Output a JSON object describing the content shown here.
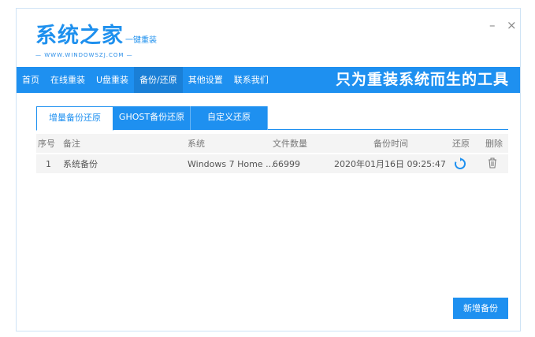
{
  "logo": {
    "main": "系统之家",
    "sub": "一键重装",
    "url": "— WWW.WINDOWSZJ.COM —"
  },
  "window": {
    "minimize": "–",
    "close": "×"
  },
  "nav": {
    "items": [
      "首页",
      "在线重装",
      "U盘重装",
      "备份/还原",
      "其他设置",
      "联系我们"
    ],
    "slogan": "只为重装系统而生的工具"
  },
  "tabs": [
    "增量备份还原",
    "GHOST备份还原",
    "自定义还原"
  ],
  "table": {
    "headers": [
      "序号",
      "备注",
      "系统",
      "文件数量",
      "备份时间",
      "还原",
      "删除"
    ],
    "rows": [
      {
        "index": "1",
        "note": "系统备份",
        "system": "Windows 7 Home ...",
        "count": "66999",
        "time": "2020年01月16日 09:25:47"
      }
    ]
  },
  "add_button": "新增备份",
  "colors": {
    "accent": "#1e90f0"
  }
}
